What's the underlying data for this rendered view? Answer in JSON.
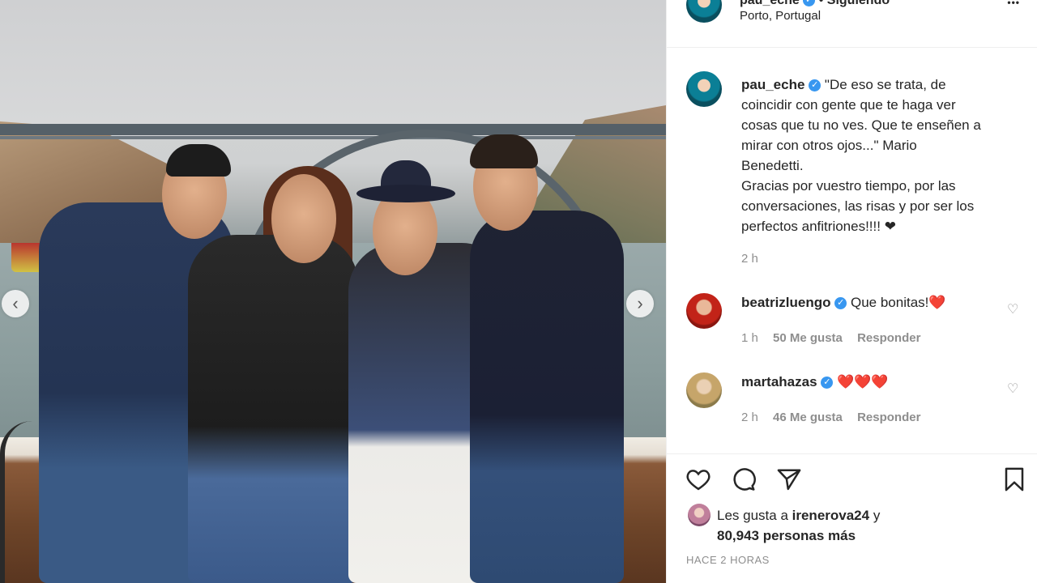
{
  "post_image": {
    "alt_subject": "photo",
    "prev_label": "‹",
    "next_label": "›"
  },
  "header": {
    "username": "pau_eche",
    "dot": "•",
    "follow_status": "Siguiendo",
    "location": "Porto, Portugal",
    "more_label": "•••"
  },
  "caption": {
    "username": "pau_eche",
    "text_line1": "\"De eso se trata, de",
    "text_line2": "coincidir con gente que te haga ver",
    "text_line3": "cosas que tu no ves. Que te enseñen a",
    "text_line4": "mirar con otros ojos...\" Mario",
    "text_line5": "Benedetti.",
    "text_line6": "Gracias por vuestro tiempo, por las",
    "text_line7": "conversaciones, las risas y por ser los",
    "text_line8": "perfectos anfitriones!!!! ❤",
    "time": "2 h"
  },
  "comments": [
    {
      "username": "beatrizluengo",
      "text": "Que bonitas!",
      "emoji": "❤️",
      "time": "1 h",
      "likes": "50 Me gusta",
      "reply": "Responder"
    },
    {
      "username": "martahazas",
      "text": "",
      "emoji": "❤️❤️❤️",
      "time": "2 h",
      "likes": "46 Me gusta",
      "reply": "Responder"
    }
  ],
  "likes": {
    "prefix": "Les gusta a",
    "user": "irenerova24",
    "conj": "y",
    "count": "80,943 personas más"
  },
  "timestamp": "HACE 2 HORAS",
  "colors": {
    "verified": "#3897f0",
    "text": "#262626",
    "muted": "#8e8e8e",
    "heart_red": "#ed4956"
  }
}
